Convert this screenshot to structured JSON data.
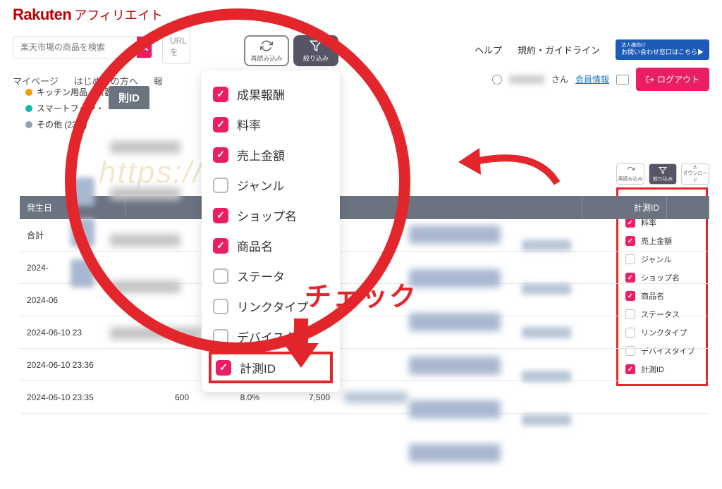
{
  "logo": {
    "brand": "Rakuten",
    "sub": "アフィリエイト"
  },
  "search": {
    "placeholder": "楽天市場の商品を検索"
  },
  "url_box": "URLを",
  "top_links": {
    "help": "ヘルプ",
    "terms": "規約・ガイドライン"
  },
  "contact_banner": {
    "line1": "法人様向け",
    "line2": "お問い合わせ窓口はこちら▶"
  },
  "nav": {
    "mypage": "マイページ",
    "beginner": "はじめての方へ",
    "report": "報"
  },
  "user": {
    "san": "さん",
    "member_info": "会員情報",
    "logout": "ログアウト"
  },
  "categories": [
    {
      "label": "キッチン用品・食器・",
      "color": "#f59e0b"
    },
    {
      "label": "スマートフォン・",
      "color": "#14b8a6"
    },
    {
      "label": "その他 (23%)",
      "color": "#94a3b8"
    }
  ],
  "gray_header": "則ID",
  "tool": {
    "reload": "再読み込み",
    "filter": "絞り込み",
    "download": "ダウンロード"
  },
  "filter_options": [
    {
      "label": "成果報酬",
      "checked": true
    },
    {
      "label": "料率",
      "checked": true
    },
    {
      "label": "売上金額",
      "checked": true
    },
    {
      "label": "ジャンル",
      "checked": false
    },
    {
      "label": "ショップ名",
      "checked": true
    },
    {
      "label": "商品名",
      "checked": true
    },
    {
      "label": "ステータス",
      "checked": false
    },
    {
      "label": "リンクタイプ",
      "checked": false
    },
    {
      "label": "デバイスタイプ",
      "checked": false
    },
    {
      "label": "計測ID",
      "checked": true
    }
  ],
  "large_filter_options": [
    {
      "label": "成果報酬",
      "checked": true
    },
    {
      "label": "料率",
      "checked": true
    },
    {
      "label": "売上金額",
      "checked": true
    },
    {
      "label": "ジャンル",
      "checked": false
    },
    {
      "label": "ショップ名",
      "checked": true
    },
    {
      "label": "商品名",
      "checked": true
    },
    {
      "label": "ステータ",
      "checked": false
    },
    {
      "label": "リンクタイプ",
      "checked": false
    },
    {
      "label": "デバイスタ",
      "checked": false
    },
    {
      "label": "計測ID",
      "checked": true,
      "highlight": true
    }
  ],
  "annotation": {
    "check": "チェック"
  },
  "table": {
    "headers": {
      "date": "発生日",
      "id": "計測ID"
    },
    "sum_row": "合計",
    "rows": [
      {
        "date": "2024-"
      },
      {
        "date": "2024-06"
      },
      {
        "date": "2024-06-10 23"
      },
      {
        "date": "2024-06-10 23:36"
      },
      {
        "date": "2024-06-10 23:35",
        "n1": "600",
        "n2": "8.0%",
        "n3": "7,500"
      }
    ]
  },
  "watermark": "https://colett"
}
